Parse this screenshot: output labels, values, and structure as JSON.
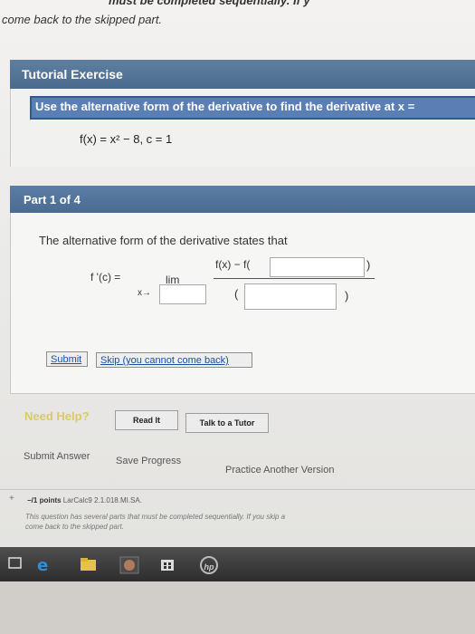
{
  "top_note": {
    "line1": "must be completed sequentially. If y",
    "line2": "come back to the skipped part."
  },
  "tutorial": {
    "title": "Tutorial Exercise",
    "instruction": "Use the alternative form of the derivative to find the derivative at x =",
    "function": "f(x) = x² − 8, c = 1"
  },
  "part": {
    "title": "Part 1 of 4",
    "text": "The alternative form of the derivative states that",
    "fprime": "f '(c) =",
    "lim": "lim",
    "x_arrow": "x→",
    "numerator_text": "f(x) − f(",
    "close_paren": ")",
    "open_paren": "(",
    "submit_label": "Submit",
    "skip_label": "Skip (you cannot come back)"
  },
  "help": {
    "need_help": "Need Help?",
    "read_it": "Read It",
    "talk_to_tutor": "Talk to a Tutor"
  },
  "bottom_links": {
    "submit_answer": "Submit Answer",
    "save_progress": "Save Progress",
    "practice_another": "Practice Another Version"
  },
  "next_question": {
    "plus": "+",
    "points": "−/1 points",
    "ref": "LarCalc9 2.1.018.MI.SA.",
    "note_line1": "This question has several parts that must be completed sequentially. If you skip a",
    "note_line2": "come back to the skipped part."
  },
  "taskbar_icons": [
    "window-icon",
    "edge-icon",
    "file-explorer-icon",
    "photo-icon",
    "store-icon",
    "hp-icon"
  ],
  "hp_logo": "hp"
}
